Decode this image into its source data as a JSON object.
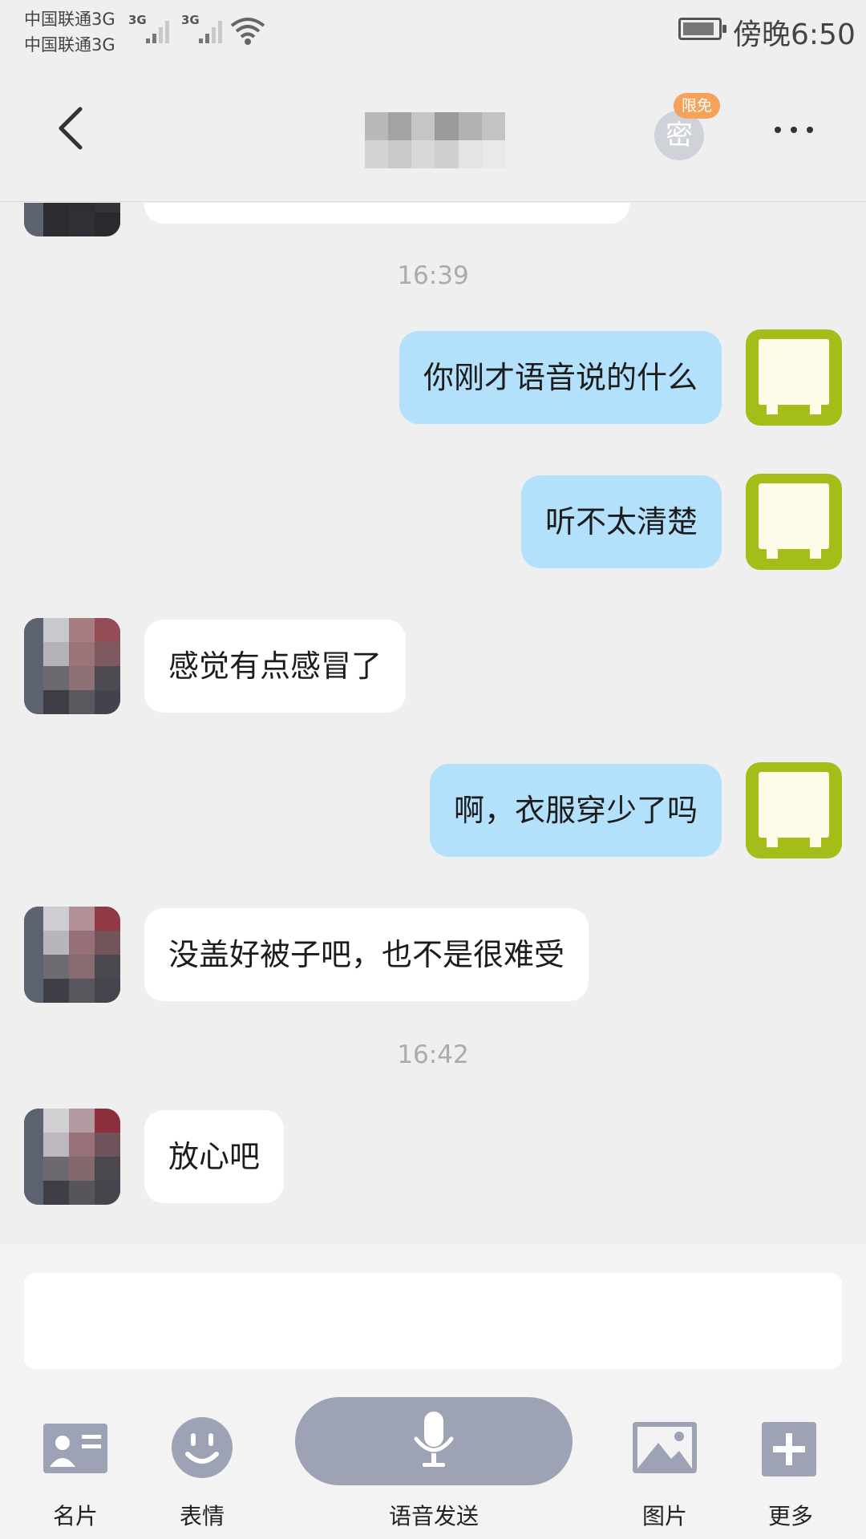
{
  "status_bar": {
    "carrier_1": "中国联通3G",
    "carrier_2": "中国联通3G",
    "network_1": "3G",
    "network_2": "3G",
    "time": "傍晚6:50",
    "icons": [
      "signal-icon",
      "signal-icon",
      "wifi-icon",
      "battery-icon"
    ]
  },
  "header": {
    "back_icon": "chevron-left-icon",
    "secret_label": "密",
    "secret_badge": "限免",
    "more_icon": "more-dots-icon"
  },
  "messages": [
    {
      "type": "time",
      "text": "16:39"
    },
    {
      "type": "msg",
      "from": "self",
      "text": "你刚才语音说的什么"
    },
    {
      "type": "msg",
      "from": "self",
      "text": "听不太清楚"
    },
    {
      "type": "msg",
      "from": "peer",
      "text": "感觉有点感冒了"
    },
    {
      "type": "msg",
      "from": "self",
      "text": "啊，衣服穿少了吗"
    },
    {
      "type": "msg",
      "from": "peer",
      "text": "没盖好被子吧，也不是很难受"
    },
    {
      "type": "time",
      "text": "16:42"
    },
    {
      "type": "msg",
      "from": "peer",
      "text": "放心吧"
    }
  ],
  "input": {
    "value": ""
  },
  "toolbar": {
    "card_label": "名片",
    "emoji_label": "表情",
    "voice_label": "语音发送",
    "image_label": "图片",
    "more_label": "更多"
  },
  "colors": {
    "self_bubble": "#b3e0fb",
    "peer_bubble": "#ffffff",
    "tool_icon": "#9da3b4",
    "badge": "#f6a25a",
    "self_avatar": "#a4bd19"
  }
}
